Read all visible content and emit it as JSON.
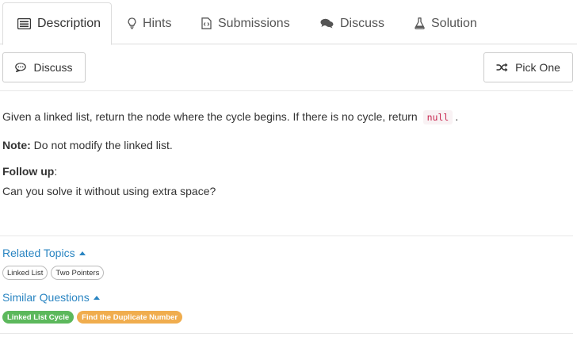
{
  "tabs": [
    {
      "label": "Description",
      "icon": "description-icon"
    },
    {
      "label": "Hints",
      "icon": "lightbulb-icon"
    },
    {
      "label": "Submissions",
      "icon": "code-file-icon"
    },
    {
      "label": "Discuss",
      "icon": "comments-icon"
    },
    {
      "label": "Solution",
      "icon": "flask-icon"
    }
  ],
  "toolbar": {
    "discuss_label": "Discuss",
    "pick_one_label": "Pick One"
  },
  "problem": {
    "line1_before": "Given a linked list, return the node where the cycle begins. If there is no cycle, return",
    "line1_code": "null",
    "line1_after": ".",
    "note_label": "Note:",
    "note_text": "Do not modify the linked list.",
    "followup_label": "Follow up",
    "followup_colon": ":",
    "followup_text": "Can you solve it without using extra space?"
  },
  "related_topics": {
    "label": "Related Topics",
    "tags": [
      "Linked List",
      "Two Pointers"
    ]
  },
  "similar_questions": {
    "label": "Similar Questions",
    "items": [
      {
        "label": "Linked List Cycle",
        "difficulty_color": "#5cb85c"
      },
      {
        "label": "Find the Duplicate Number",
        "difficulty_color": "#f0ad4e"
      }
    ]
  },
  "colors": {
    "link": "#2a85c2",
    "easy": "#5cb85c",
    "medium": "#f0ad4e",
    "code": "#c7254e"
  }
}
